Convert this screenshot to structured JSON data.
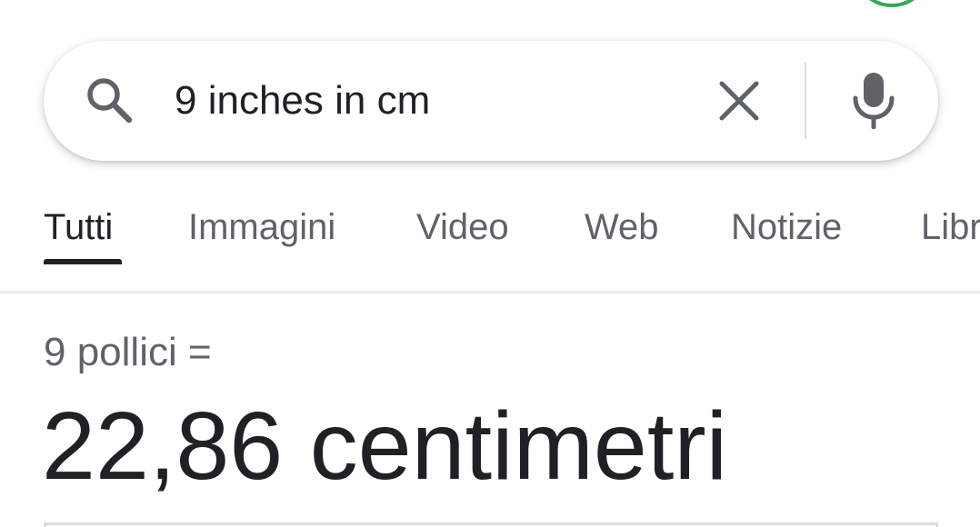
{
  "search": {
    "query": "9 inches in cm",
    "icons": {
      "search": "search-icon",
      "clear": "close-icon",
      "voice": "microphone-icon"
    }
  },
  "tabs": [
    {
      "label": "Tutti",
      "active": true
    },
    {
      "label": "Immagini",
      "active": false
    },
    {
      "label": "Video",
      "active": false
    },
    {
      "label": "Web",
      "active": false
    },
    {
      "label": "Notizie",
      "active": false
    },
    {
      "label": "Libri",
      "active": false
    }
  ],
  "conversion": {
    "from_text": "9 pollici =",
    "result_text": "22,86 centimetri"
  },
  "colors": {
    "text_primary": "#202124",
    "text_secondary": "#5f6368",
    "divider": "#dadce0",
    "account_ring": "#34a853"
  }
}
